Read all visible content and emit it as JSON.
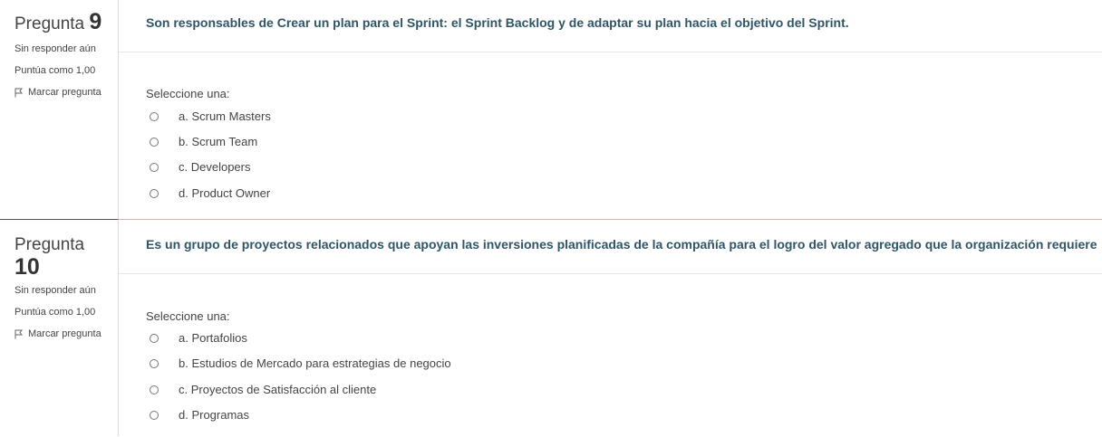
{
  "questions": [
    {
      "label": "Pregunta",
      "number": "9",
      "status": "Sin responder aún",
      "score": "Puntúa como 1,00",
      "flag_label": "Marcar pregunta",
      "text": "Son responsables de Crear un plan para el Sprint: el Sprint Backlog y de adaptar su plan hacia el objetivo del Sprint.",
      "prompt": "Seleccione una:",
      "options": [
        "a. Scrum Masters",
        "b. Scrum Team",
        "c. Developers",
        "d. Product Owner"
      ]
    },
    {
      "label": "Pregunta",
      "number": "10",
      "status": "Sin responder aún",
      "score": "Puntúa como 1,00",
      "flag_label": "Marcar pregunta",
      "text": "Es un grupo de proyectos relacionados que apoyan las inversiones planificadas de la compañía para el logro del valor agregado que la organización requiere",
      "prompt": "Seleccione una:",
      "options": [
        "a. Portafolios",
        "b. Estudios de Mercado para estrategias de negocio",
        "c. Proyectos de Satisfacción al cliente",
        "d. Programas"
      ]
    }
  ]
}
